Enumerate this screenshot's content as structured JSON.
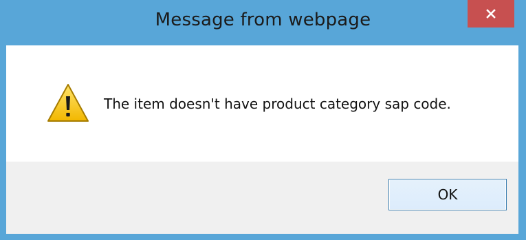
{
  "window": {
    "title": "Message from webpage",
    "close_icon": "close-icon",
    "accent_color": "#58a6d8",
    "close_color": "#c75050"
  },
  "dialog": {
    "icon": "warning-icon",
    "message": "The item doesn't have product category sap code.",
    "ok_label": "OK"
  }
}
